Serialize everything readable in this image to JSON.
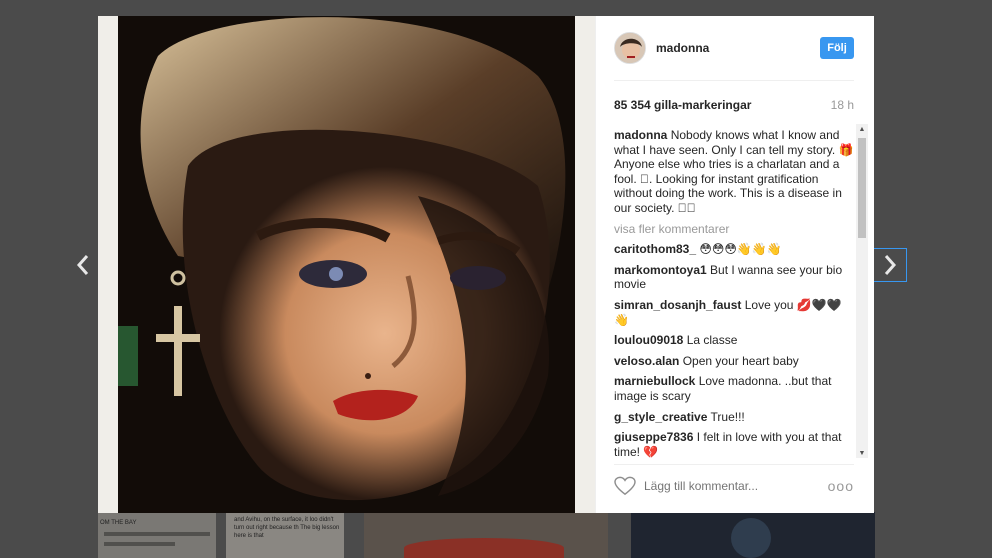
{
  "post": {
    "username": "madonna",
    "follow_label": "Följ",
    "likes": "85 354 gilla-markeringar",
    "time": "18 h",
    "more_comments": "visa fler kommentarer",
    "add_comment_placeholder": "Lägg till kommentar...",
    "options_glyph": "ooo"
  },
  "comments": [
    {
      "user": "madonna",
      "text": "Nobody knows what I know and what I have seen. Only I can tell my story. 🎁Anyone else who tries is a charlatan and a fool. ⃞. Looking for instant gratification without doing the work. This is a disease in our society. 🏔⃞"
    },
    {
      "user": "caritothom83_",
      "text": "😳😳😳👋👋👋"
    },
    {
      "user": "markomontoya1",
      "text": "But I wanna see your bio movie"
    },
    {
      "user": "simran_dosanjh_faust",
      "text": "Love you 💋🖤🖤👋"
    },
    {
      "user": "loulou09018",
      "text": "La classe"
    },
    {
      "user": "veloso.alan",
      "text": "Open your heart baby"
    },
    {
      "user": "marniebullock",
      "text": "Love madonna. ..but that image is scary"
    },
    {
      "user": "g_style_creative",
      "text": "True!!!"
    },
    {
      "user": "giuseppe7836",
      "text": "I felt in love with you at that time! 💔"
    }
  ],
  "icons": {
    "prev": "chevron-left-icon",
    "next": "chevron-right-icon",
    "like": "heart-outline-icon",
    "more": "more-dots-icon"
  },
  "colors": {
    "accent": "#3897f0",
    "text": "#262626",
    "muted": "#999999",
    "backdrop": "#4b4b4b"
  },
  "background_page": {
    "tile1_text": "OM THE BAY",
    "tile2_text": "and Avihu, on the surface, it loo didn't turn out right because th The big lesson here is that"
  }
}
